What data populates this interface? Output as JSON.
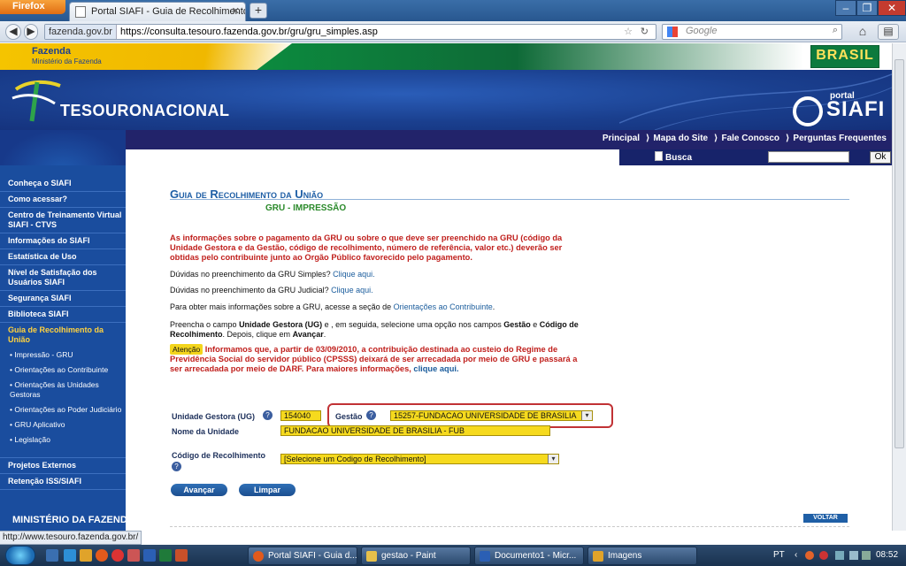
{
  "browser": {
    "app_button": "Firefox",
    "tab_title": "Portal SIAFI - Guia de Recolhimento da ...",
    "url_site": "fazenda.gov.br",
    "url": "https://consulta.tesouro.fazenda.gov.br/gru/gru_simples.asp",
    "search_placeholder": "Google"
  },
  "header": {
    "fazenda_title": "Fazenda",
    "fazenda_sub": "Ministério da Fazenda",
    "brasil": "BRASIL",
    "tesouro": "TESOURONACIONAL",
    "portal": "portal",
    "siafi": "SIAFI",
    "menu": [
      "Principal",
      "Mapa do Site",
      "Fale Conosco",
      "Perguntas Frequentes"
    ],
    "busca_label": "Busca",
    "ok_label": "Ok"
  },
  "sidebar": {
    "items": [
      "Conheça o SIAFI",
      "Como acessar?",
      "Centro de Treinamento Virtual SIAFI - CTVS",
      "Informações do SIAFI",
      "Estatística de Uso",
      "Nível de Satisfação dos Usuários SIAFI",
      "Segurança SIAFI",
      "Biblioteca SIAFI",
      "Guia de Recolhimento da União"
    ],
    "subitems": [
      "Impressão - GRU",
      "Orientações ao Contribuinte",
      "Orientações às Unidades Gestoras",
      "Orientações ao Poder Judiciário",
      "GRU Aplicativo",
      "Legislação"
    ],
    "items_after": [
      "Projetos Externos",
      "Retenção ISS/SIAFI"
    ],
    "footer": "MINISTÉRIO DA FAZENDA"
  },
  "main": {
    "title": "Guia de Recolhimento da União",
    "subtitle": "GRU - IMPRESSÃO",
    "warning": "As informações sobre o pagamento da GRU ou sobre o que deve ser preenchido na GRU (código da Unidade Gestora e da Gestão, código de recolhimento, número de referência, valor etc.) deverão ser obtidas pelo contribuinte junto ao Orgão Público favorecido pelo pagamento.",
    "duvidas_simples": "Dúvidas no preenchimento da GRU Simples?",
    "duvidas_judicial": "Dúvidas no preenchimento da GRU Judicial?",
    "clique_aqui": "Clique aqui.",
    "mais_info": "Para obter mais informações sobre a GRU, acesse a seção de",
    "orient_link": "Orientações ao Contribuinte",
    "preencha_1": "Preencha o campo",
    "preencha_ug": "Unidade Gestora (UG)",
    "preencha_2": "e , em seguida, selecione uma opção nos campos",
    "preencha_gestao": "Gestão",
    "preencha_e": "e",
    "preencha_cod": "Código de Recolhimento",
    "preencha_3": ". Depois, clique em",
    "preencha_av": "Avançar",
    "atencao": "Atenção",
    "atencao_text": "Informamos que, a partir de 03/09/2010, a contribuição destinada ao custeio do Regime de Previdência Social do servidor público (CPSSS) deixará de ser arrecadada por meio de GRU e passará a ser arrecadada por meio de DARF. Para maiores informações,",
    "clique_aqui_lower": "clique aqui."
  },
  "form": {
    "ug_label": "Unidade Gestora (UG)",
    "ug_value": "154040",
    "gestao_label": "Gestão",
    "gestao_value": "15257-FUNDACAO UNIVERSIDADE DE BRASILIA",
    "nome_label": "Nome da Unidade",
    "nome_value": "FUNDACAO UNIVERSIDADE DE BRASILIA - FUB",
    "codigo_label": "Código de Recolhimento",
    "codigo_value": "[Selecione um Codigo de Recolhimento]",
    "avancar": "Avançar",
    "limpar": "Limpar",
    "voltar": "VOLTAR"
  },
  "status_url": "http://www.tesouro.fazenda.gov.br/",
  "taskbar": {
    "tasks": [
      "Portal SIAFI - Guia d...",
      "gestao - Paint",
      "Documento1 - Micr...",
      "Imagens"
    ],
    "lang": "PT",
    "clock": "08:52"
  },
  "colors": {
    "accent": "#1a4d9e",
    "warning_red": "#c0201d",
    "field_yellow": "#f6da1e"
  }
}
